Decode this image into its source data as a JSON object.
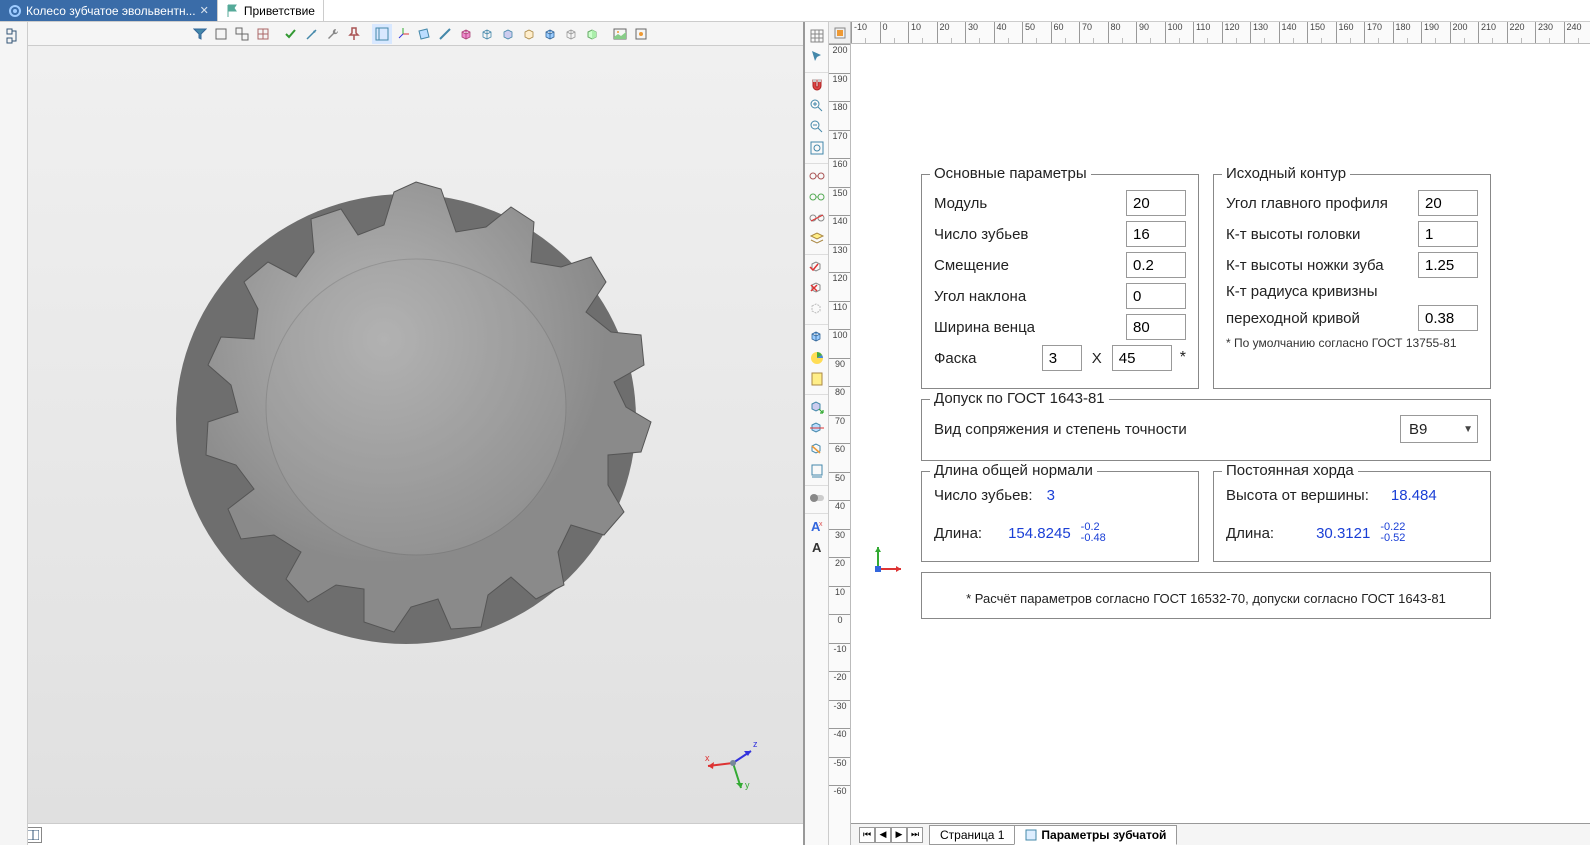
{
  "tabs": {
    "active": "Колесо зубчатое эвольвентн...",
    "inactive": "Приветствие"
  },
  "rulerH": [
    -10,
    0,
    10,
    20,
    30,
    40,
    50,
    60,
    70,
    80,
    90,
    100,
    110,
    120,
    130,
    140,
    150,
    160,
    170,
    180,
    190,
    200,
    210,
    220,
    230,
    240
  ],
  "rulerV": [
    200,
    190,
    180,
    170,
    160,
    150,
    140,
    130,
    120,
    110,
    100,
    90,
    80,
    70,
    60,
    50,
    40,
    30,
    20,
    10,
    0,
    -10,
    -20,
    -30,
    -40,
    -50,
    -60
  ],
  "groups": {
    "main": {
      "title": "Основные параметры",
      "module_label": "Модуль",
      "module_val": "20",
      "teeth_label": "Число зубьев",
      "teeth_val": "16",
      "offset_label": "Смещение",
      "offset_val": "0.2",
      "angle_label": "Угол наклона",
      "angle_val": "0",
      "width_label": "Ширина венца",
      "width_val": "80",
      "chamfer_label": "Фаска",
      "chamfer_a": "3",
      "chamfer_x": "X",
      "chamfer_b": "45",
      "chamfer_star": "*"
    },
    "contour": {
      "title": "Исходный контур",
      "profile_angle_label": "Угол главного профиля",
      "profile_angle_val": "20",
      "addendum_label": "К-т высоты головки",
      "addendum_val": "1",
      "dedendum_label": "К-т высоты ножки зуба",
      "dedendum_val": "1.25",
      "fillet_label1": "К-т радиуса кривизны",
      "fillet_label2": "переходной кривой",
      "fillet_val": "0.38",
      "note": "* По умолчанию согласно  ГОСТ 13755-81"
    },
    "tolerance": {
      "title": "Допуск по ГОСТ 1643-81",
      "label": "Вид сопряжения и степень точности",
      "value": "B9"
    },
    "normal": {
      "title": "Длина общей нормали",
      "teeth_label": "Число зубьев:",
      "teeth_val": "3",
      "length_label": "Длина:",
      "length_val": "154.8245",
      "tol_up": "-0.2",
      "tol_dn": "-0.48"
    },
    "chord": {
      "title": "Постоянная хорда",
      "height_label": "Высота от вершины:",
      "height_val": "18.484",
      "length_label": "Длина:",
      "length_val": "30.3121",
      "tol_up": "-0.22",
      "tol_dn": "-0.52"
    },
    "calc_note": "* Расчёт параметров согласно ГОСТ 16532-70, допуски согласно ГОСТ 1643-81"
  },
  "sheets": {
    "page1": "Страница 1",
    "params": "Параметры зубчатой"
  }
}
